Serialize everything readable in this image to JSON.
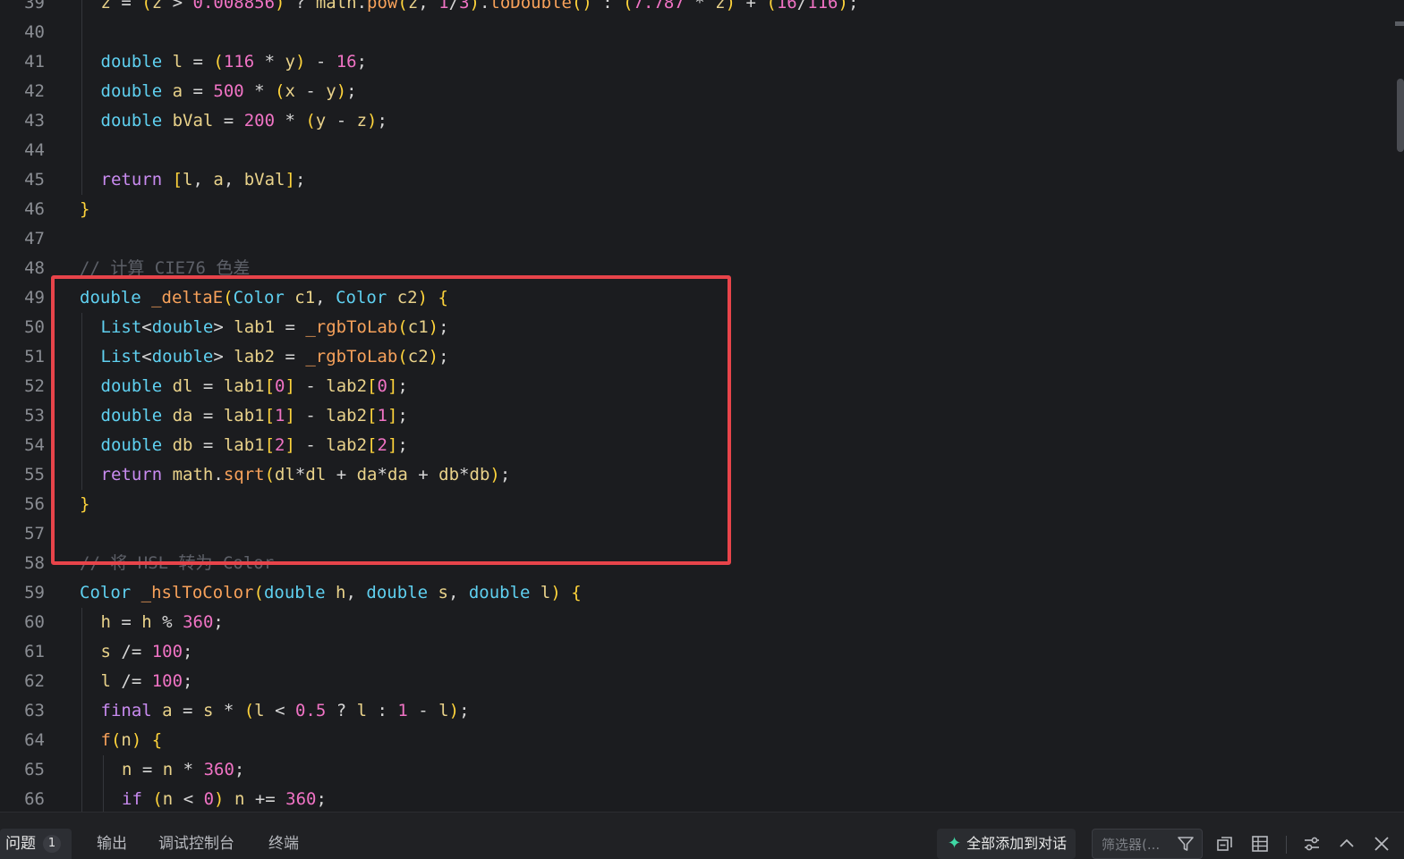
{
  "editor": {
    "lines": [
      {
        "n": "39",
        "tokens": [
          [
            "va",
            "z"
          ],
          [
            "pn",
            " = "
          ],
          [
            "br",
            "("
          ],
          [
            "va",
            "z"
          ],
          [
            "pn",
            " > "
          ],
          [
            "num",
            "0.008856"
          ],
          [
            "br",
            ")"
          ],
          [
            "pn",
            " ? "
          ],
          [
            "va",
            "math"
          ],
          [
            "pn",
            "."
          ],
          [
            "fn",
            "pow"
          ],
          [
            "br",
            "("
          ],
          [
            "va",
            "z"
          ],
          [
            "pn",
            ", "
          ],
          [
            "num",
            "1"
          ],
          [
            "pn",
            "/"
          ],
          [
            "num",
            "3"
          ],
          [
            "br",
            ")"
          ],
          [
            "pn",
            "."
          ],
          [
            "fn",
            "toDouble"
          ],
          [
            "br",
            "()"
          ],
          [
            "pn",
            " : "
          ],
          [
            "br",
            "("
          ],
          [
            "num",
            "7.787"
          ],
          [
            "pn",
            " * "
          ],
          [
            "va",
            "z"
          ],
          [
            "br",
            ")"
          ],
          [
            "pn",
            " + "
          ],
          [
            "br",
            "("
          ],
          [
            "num",
            "16"
          ],
          [
            "pn",
            "/"
          ],
          [
            "num",
            "116"
          ],
          [
            "br",
            ")"
          ],
          [
            "pn",
            ";"
          ]
        ],
        "indent": 1
      },
      {
        "n": "40",
        "tokens": [],
        "indent": 1
      },
      {
        "n": "41",
        "tokens": [
          [
            "ty",
            "double"
          ],
          [
            "pn",
            " "
          ],
          [
            "va",
            "l"
          ],
          [
            "pn",
            " = "
          ],
          [
            "br",
            "("
          ],
          [
            "num",
            "116"
          ],
          [
            "pn",
            " * "
          ],
          [
            "va",
            "y"
          ],
          [
            "br",
            ")"
          ],
          [
            "pn",
            " - "
          ],
          [
            "num",
            "16"
          ],
          [
            "pn",
            ";"
          ]
        ],
        "indent": 1
      },
      {
        "n": "42",
        "tokens": [
          [
            "ty",
            "double"
          ],
          [
            "pn",
            " "
          ],
          [
            "va",
            "a"
          ],
          [
            "pn",
            " = "
          ],
          [
            "num",
            "500"
          ],
          [
            "pn",
            " * "
          ],
          [
            "br",
            "("
          ],
          [
            "va",
            "x"
          ],
          [
            "pn",
            " - "
          ],
          [
            "va",
            "y"
          ],
          [
            "br",
            ")"
          ],
          [
            "pn",
            ";"
          ]
        ],
        "indent": 1
      },
      {
        "n": "43",
        "tokens": [
          [
            "ty",
            "double"
          ],
          [
            "pn",
            " "
          ],
          [
            "va",
            "bVal"
          ],
          [
            "pn",
            " = "
          ],
          [
            "num",
            "200"
          ],
          [
            "pn",
            " * "
          ],
          [
            "br",
            "("
          ],
          [
            "va",
            "y"
          ],
          [
            "pn",
            " - "
          ],
          [
            "va",
            "z"
          ],
          [
            "br",
            ")"
          ],
          [
            "pn",
            ";"
          ]
        ],
        "indent": 1
      },
      {
        "n": "44",
        "tokens": [],
        "indent": 1
      },
      {
        "n": "45",
        "tokens": [
          [
            "kw",
            "return"
          ],
          [
            "pn",
            " "
          ],
          [
            "br",
            "["
          ],
          [
            "va",
            "l"
          ],
          [
            "pn",
            ", "
          ],
          [
            "va",
            "a"
          ],
          [
            "pn",
            ", "
          ],
          [
            "va",
            "bVal"
          ],
          [
            "br",
            "]"
          ],
          [
            "pn",
            ";"
          ]
        ],
        "indent": 1
      },
      {
        "n": "46",
        "tokens": [
          [
            "br",
            "}"
          ]
        ],
        "indent": 0
      },
      {
        "n": "47",
        "tokens": [],
        "indent": 0
      },
      {
        "n": "48",
        "tokens": [
          [
            "cm",
            "// 计算 CIE76 色差"
          ]
        ],
        "indent": 0
      },
      {
        "n": "49",
        "tokens": [
          [
            "ty",
            "double"
          ],
          [
            "pn",
            " "
          ],
          [
            "fn",
            "_deltaE"
          ],
          [
            "br",
            "("
          ],
          [
            "ty",
            "Color"
          ],
          [
            "pn",
            " "
          ],
          [
            "va",
            "c1"
          ],
          [
            "pn",
            ", "
          ],
          [
            "ty",
            "Color"
          ],
          [
            "pn",
            " "
          ],
          [
            "va",
            "c2"
          ],
          [
            "br",
            ")"
          ],
          [
            "pn",
            " "
          ],
          [
            "br",
            "{"
          ]
        ],
        "indent": 0
      },
      {
        "n": "50",
        "tokens": [
          [
            "ty",
            "List"
          ],
          [
            "pn",
            "<"
          ],
          [
            "ty",
            "double"
          ],
          [
            "pn",
            "> "
          ],
          [
            "va",
            "lab1"
          ],
          [
            "pn",
            " = "
          ],
          [
            "fn",
            "_rgbToLab"
          ],
          [
            "br",
            "("
          ],
          [
            "va",
            "c1"
          ],
          [
            "br",
            ")"
          ],
          [
            "pn",
            ";"
          ]
        ],
        "indent": 1
      },
      {
        "n": "51",
        "tokens": [
          [
            "ty",
            "List"
          ],
          [
            "pn",
            "<"
          ],
          [
            "ty",
            "double"
          ],
          [
            "pn",
            "> "
          ],
          [
            "va",
            "lab2"
          ],
          [
            "pn",
            " = "
          ],
          [
            "fn",
            "_rgbToLab"
          ],
          [
            "br",
            "("
          ],
          [
            "va",
            "c2"
          ],
          [
            "br",
            ")"
          ],
          [
            "pn",
            ";"
          ]
        ],
        "indent": 1
      },
      {
        "n": "52",
        "tokens": [
          [
            "ty",
            "double"
          ],
          [
            "pn",
            " "
          ],
          [
            "va",
            "dl"
          ],
          [
            "pn",
            " = "
          ],
          [
            "va",
            "lab1"
          ],
          [
            "br",
            "["
          ],
          [
            "num",
            "0"
          ],
          [
            "br",
            "]"
          ],
          [
            "pn",
            " - "
          ],
          [
            "va",
            "lab2"
          ],
          [
            "br",
            "["
          ],
          [
            "num",
            "0"
          ],
          [
            "br",
            "]"
          ],
          [
            "pn",
            ";"
          ]
        ],
        "indent": 1
      },
      {
        "n": "53",
        "tokens": [
          [
            "ty",
            "double"
          ],
          [
            "pn",
            " "
          ],
          [
            "va",
            "da"
          ],
          [
            "pn",
            " = "
          ],
          [
            "va",
            "lab1"
          ],
          [
            "br",
            "["
          ],
          [
            "num",
            "1"
          ],
          [
            "br",
            "]"
          ],
          [
            "pn",
            " - "
          ],
          [
            "va",
            "lab2"
          ],
          [
            "br",
            "["
          ],
          [
            "num",
            "1"
          ],
          [
            "br",
            "]"
          ],
          [
            "pn",
            ";"
          ]
        ],
        "indent": 1
      },
      {
        "n": "54",
        "tokens": [
          [
            "ty",
            "double"
          ],
          [
            "pn",
            " "
          ],
          [
            "va",
            "db"
          ],
          [
            "pn",
            " = "
          ],
          [
            "va",
            "lab1"
          ],
          [
            "br",
            "["
          ],
          [
            "num",
            "2"
          ],
          [
            "br",
            "]"
          ],
          [
            "pn",
            " - "
          ],
          [
            "va",
            "lab2"
          ],
          [
            "br",
            "["
          ],
          [
            "num",
            "2"
          ],
          [
            "br",
            "]"
          ],
          [
            "pn",
            ";"
          ]
        ],
        "indent": 1
      },
      {
        "n": "55",
        "tokens": [
          [
            "kw",
            "return"
          ],
          [
            "pn",
            " "
          ],
          [
            "va",
            "math"
          ],
          [
            "pn",
            "."
          ],
          [
            "fn",
            "sqrt"
          ],
          [
            "br",
            "("
          ],
          [
            "va",
            "dl"
          ],
          [
            "pn",
            "*"
          ],
          [
            "va",
            "dl"
          ],
          [
            "pn",
            " + "
          ],
          [
            "va",
            "da"
          ],
          [
            "pn",
            "*"
          ],
          [
            "va",
            "da"
          ],
          [
            "pn",
            " + "
          ],
          [
            "va",
            "db"
          ],
          [
            "pn",
            "*"
          ],
          [
            "va",
            "db"
          ],
          [
            "br",
            ")"
          ],
          [
            "pn",
            ";"
          ]
        ],
        "indent": 1
      },
      {
        "n": "56",
        "tokens": [
          [
            "br",
            "}"
          ]
        ],
        "indent": 0
      },
      {
        "n": "57",
        "tokens": [],
        "indent": 0
      },
      {
        "n": "58",
        "tokens": [
          [
            "cm",
            "// 将 HSL 转为 Color"
          ]
        ],
        "indent": 0
      },
      {
        "n": "59",
        "tokens": [
          [
            "ty",
            "Color"
          ],
          [
            "pn",
            " "
          ],
          [
            "fn",
            "_hslToColor"
          ],
          [
            "br",
            "("
          ],
          [
            "ty",
            "double"
          ],
          [
            "pn",
            " "
          ],
          [
            "va",
            "h"
          ],
          [
            "pn",
            ", "
          ],
          [
            "ty",
            "double"
          ],
          [
            "pn",
            " "
          ],
          [
            "va",
            "s"
          ],
          [
            "pn",
            ", "
          ],
          [
            "ty",
            "double"
          ],
          [
            "pn",
            " "
          ],
          [
            "va",
            "l"
          ],
          [
            "br",
            ")"
          ],
          [
            "pn",
            " "
          ],
          [
            "br",
            "{"
          ]
        ],
        "indent": 0
      },
      {
        "n": "60",
        "tokens": [
          [
            "va",
            "h"
          ],
          [
            "pn",
            " = "
          ],
          [
            "va",
            "h"
          ],
          [
            "pn",
            " % "
          ],
          [
            "num",
            "360"
          ],
          [
            "pn",
            ";"
          ]
        ],
        "indent": 1
      },
      {
        "n": "61",
        "tokens": [
          [
            "va",
            "s"
          ],
          [
            "pn",
            " /= "
          ],
          [
            "num",
            "100"
          ],
          [
            "pn",
            ";"
          ]
        ],
        "indent": 1
      },
      {
        "n": "62",
        "tokens": [
          [
            "va",
            "l"
          ],
          [
            "pn",
            " /= "
          ],
          [
            "num",
            "100"
          ],
          [
            "pn",
            ";"
          ]
        ],
        "indent": 1
      },
      {
        "n": "63",
        "tokens": [
          [
            "kw",
            "final"
          ],
          [
            "pn",
            " "
          ],
          [
            "va",
            "a"
          ],
          [
            "pn",
            " = "
          ],
          [
            "va",
            "s"
          ],
          [
            "pn",
            " * "
          ],
          [
            "br",
            "("
          ],
          [
            "va",
            "l"
          ],
          [
            "pn",
            " < "
          ],
          [
            "num",
            "0.5"
          ],
          [
            "pn",
            " ? "
          ],
          [
            "va",
            "l"
          ],
          [
            "pn",
            " : "
          ],
          [
            "num",
            "1"
          ],
          [
            "pn",
            " - "
          ],
          [
            "va",
            "l"
          ],
          [
            "br",
            ")"
          ],
          [
            "pn",
            ";"
          ]
        ],
        "indent": 1
      },
      {
        "n": "64",
        "tokens": [
          [
            "fn",
            "f"
          ],
          [
            "br",
            "("
          ],
          [
            "va",
            "n"
          ],
          [
            "br",
            ")"
          ],
          [
            "pn",
            " "
          ],
          [
            "br",
            "{"
          ]
        ],
        "indent": 1
      },
      {
        "n": "65",
        "tokens": [
          [
            "va",
            "n"
          ],
          [
            "pn",
            " = "
          ],
          [
            "va",
            "n"
          ],
          [
            "pn",
            " * "
          ],
          [
            "num",
            "360"
          ],
          [
            "pn",
            ";"
          ]
        ],
        "indent": 2
      },
      {
        "n": "66",
        "tokens": [
          [
            "kw",
            "if"
          ],
          [
            "pn",
            " "
          ],
          [
            "br",
            "("
          ],
          [
            "va",
            "n"
          ],
          [
            "pn",
            " < "
          ],
          [
            "num",
            "0"
          ],
          [
            "br",
            ")"
          ],
          [
            "pn",
            " "
          ],
          [
            "va",
            "n"
          ],
          [
            "pn",
            " += "
          ],
          [
            "num",
            "360"
          ],
          [
            "pn",
            ";"
          ]
        ],
        "indent": 2
      }
    ]
  },
  "panel": {
    "tabs": [
      {
        "label": "问题",
        "badge": "1",
        "active": true
      },
      {
        "label": "输出"
      },
      {
        "label": "调试控制台"
      },
      {
        "label": "终端"
      }
    ],
    "add_all_to_chat": "全部添加到对话",
    "filter_placeholder": "筛选器(..."
  },
  "colors": {
    "highlight_box": "#e8444a",
    "editor_bg": "#1b1c1f",
    "accent": "#3fd8a5"
  }
}
